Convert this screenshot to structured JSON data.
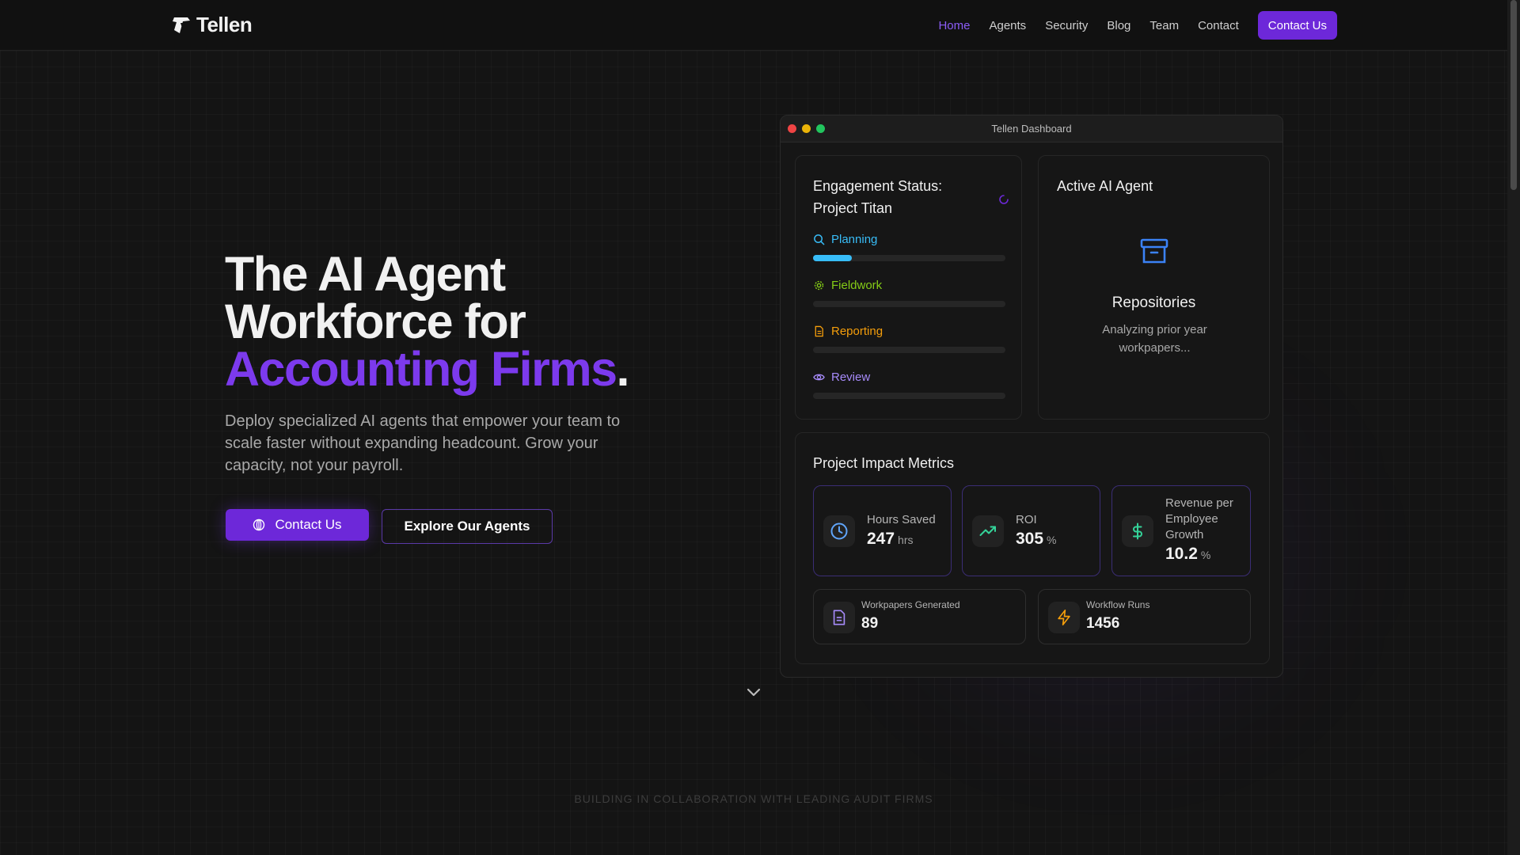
{
  "brand": {
    "name": "Tellen"
  },
  "nav": {
    "items": [
      {
        "label": "Home",
        "active": true
      },
      {
        "label": "Agents"
      },
      {
        "label": "Security"
      },
      {
        "label": "Blog"
      },
      {
        "label": "Team"
      },
      {
        "label": "Contact"
      }
    ],
    "cta_label": "Contact Us"
  },
  "hero": {
    "title_line1": "The AI Agent",
    "title_line2": "Workforce for",
    "title_accent": "Accounting Firms",
    "title_period": ".",
    "subtitle": "Deploy specialized AI agents that empower your team to scale faster without expanding headcount. Grow your capacity, not your payroll.",
    "primary_button": "Contact Us",
    "secondary_button": "Explore Our Agents"
  },
  "dashboard": {
    "window_title": "Tellen Dashboard",
    "engagement": {
      "title": "Engagement Status: Project Titan",
      "stages": [
        {
          "label": "Planning",
          "color": "#38bdf8",
          "progress": 0.2
        },
        {
          "label": "Fieldwork",
          "color": "#84cc16",
          "progress": 0
        },
        {
          "label": "Reporting",
          "color": "#f59e0b",
          "progress": 0
        },
        {
          "label": "Review",
          "color": "#a78bfa",
          "progress": 0
        }
      ]
    },
    "active_agent": {
      "title": "Active AI Agent",
      "name": "Repositories",
      "status": "Analyzing prior year workpapers..."
    },
    "metrics": {
      "title": "Project Impact Metrics",
      "hours_saved": {
        "label": "Hours Saved",
        "value": "247",
        "unit": "hrs"
      },
      "roi": {
        "label": "ROI",
        "value": "305",
        "unit": "%"
      },
      "revenue": {
        "label": "Revenue per Employee Growth",
        "value": "10.2",
        "unit": "%"
      },
      "workpapers": {
        "label": "Workpapers Generated",
        "value": "89"
      },
      "workflows": {
        "label": "Workflow Runs",
        "value": "1456"
      }
    }
  },
  "footer_note": "BUILDING IN COLLABORATION WITH LEADING AUDIT FIRMS",
  "colors": {
    "accent": "#7c3aed",
    "button": "#6d28d9",
    "background": "#141414"
  }
}
